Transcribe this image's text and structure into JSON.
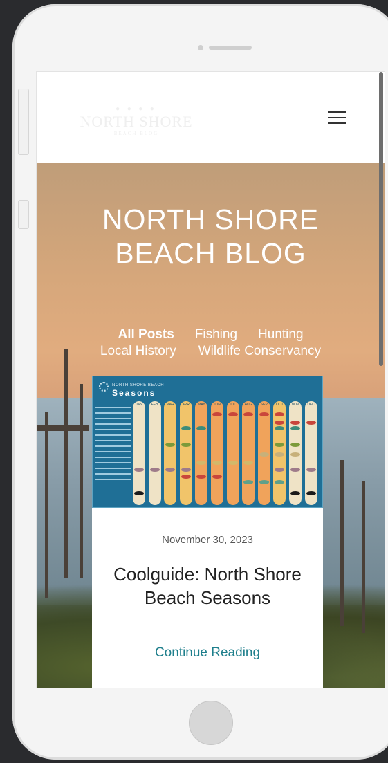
{
  "site": {
    "blog_title_line1": "NORTH SHORE",
    "blog_title_line2": "BEACH BLOG"
  },
  "nav": {
    "categories": [
      "All Posts",
      "Fishing",
      "Hunting",
      "Local History",
      "Wildlife Conservancy"
    ],
    "active": "All Posts"
  },
  "post": {
    "image_title_small": "NORTH SHORE BEACH",
    "image_title_big": "Seasons",
    "months": [
      "JAN",
      "FEB",
      "MAR",
      "APR",
      "MAY",
      "JUN",
      "JUL",
      "AUG",
      "SEP",
      "OCT",
      "NOV",
      "DEC"
    ],
    "date": "November 30, 2023",
    "title": "Coolguide: North Shore Beach Seasons",
    "continue_label": "Continue Reading"
  },
  "colors": {
    "accent_link": "#1f7f8c",
    "infographic_bg": "#1f6f96"
  },
  "icons": {
    "menu": "hamburger-menu-icon",
    "logo": "site-logo"
  }
}
